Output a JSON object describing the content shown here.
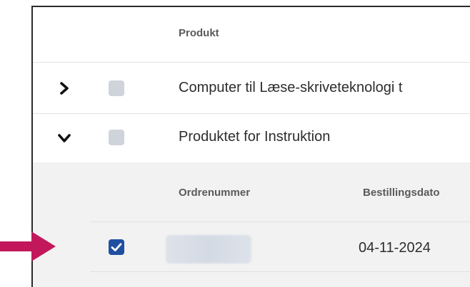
{
  "table": {
    "header": {
      "product_col": "Produkt"
    },
    "rows": [
      {
        "name": "Computer til Læse-skriveteknologi t",
        "expanded": false,
        "checked": false
      },
      {
        "name": "Produktet for Instruktion",
        "expanded": true,
        "checked": false
      }
    ],
    "subtable": {
      "header": {
        "order_col": "Ordrenummer",
        "date_col": "Bestillingsdato"
      },
      "rows": [
        {
          "order_number": "",
          "order_date": "04-11-2024",
          "checked": true
        }
      ]
    }
  },
  "colors": {
    "arrow": "#c2185b",
    "checkbox_checked": "#1f4fa1",
    "checkbox_unchecked": "#cfd4da",
    "subtable_bg": "#f2f2f2"
  }
}
